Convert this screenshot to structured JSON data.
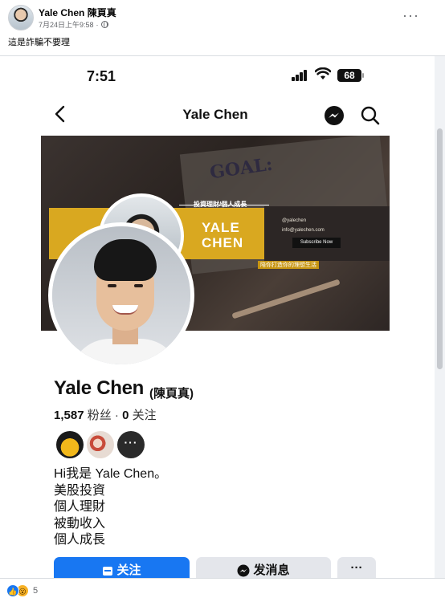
{
  "post": {
    "author": "Yale Chen 陳頁真",
    "timestamp": "7月24日上午9:58",
    "audience_icon": "globe-icon",
    "more_label": "···",
    "caption": "這是詐騙不要理"
  },
  "phone": {
    "status": {
      "time": "7:51",
      "battery": "68"
    },
    "nav": {
      "title": "Yale Chen"
    },
    "cover": {
      "goal_text": "GOAL:",
      "top_label": "投資理財/個人成長",
      "brand_line1": "YALE",
      "brand_line2": "CHEN",
      "link1": "@yalechen",
      "link2": "info@yalechen.com",
      "subscribe": "Subscribe Now",
      "bottom_label": "陪你打造你的理想生活"
    },
    "profile": {
      "name": "Yale Chen",
      "alt_name": "(陳頁真)",
      "followers_count": "1,587",
      "followers_label": "粉丝",
      "following_count": "0",
      "following_label": "关注",
      "friends_more": "···",
      "bio": [
        "Hi我是 Yale Chen。",
        "美股投資",
        "個人理財",
        "被動收入",
        "個人成長"
      ]
    },
    "actions": {
      "follow": "关注",
      "message": "发消息",
      "more": "···"
    }
  },
  "reactions": {
    "count": "5"
  },
  "colors": {
    "primary": "#1877f2",
    "accent": "#d9a820"
  }
}
